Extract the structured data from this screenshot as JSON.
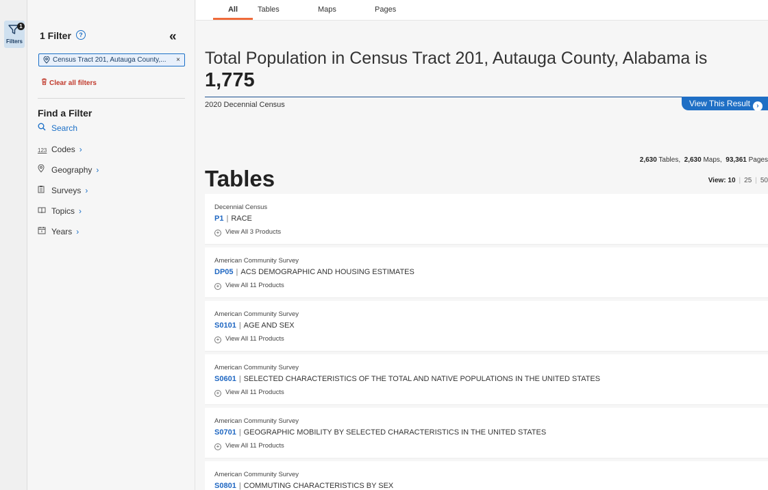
{
  "rail": {
    "filter_label": "Filters",
    "badge_count": "1"
  },
  "panel": {
    "title": "1 Filter",
    "chip_label": "Census Tract 201, Autauga County,...",
    "chip_close": "×",
    "clear_all": "Clear all filters",
    "find_title": "Find a Filter",
    "nav": [
      {
        "label": "Search",
        "icon": "search-icon"
      },
      {
        "label": "Codes",
        "icon": "codes-icon",
        "icon_text": "123"
      },
      {
        "label": "Geography",
        "icon": "location-pin-icon"
      },
      {
        "label": "Surveys",
        "icon": "clipboard-icon"
      },
      {
        "label": "Topics",
        "icon": "book-icon"
      },
      {
        "label": "Years",
        "icon": "calendar-icon"
      }
    ]
  },
  "tabs": [
    "All",
    "Tables",
    "Maps",
    "Pages"
  ],
  "headline": {
    "text": "Total Population in Census Tract 201, Autauga County, Alabama is ",
    "value": "1,775",
    "sub": "2020 Decennial Census",
    "button": "View This Result"
  },
  "counts": {
    "tables_num": "2,630",
    "tables_label": "Tables,",
    "maps_num": "2,630",
    "maps_label": "Maps,",
    "pages_num": "93,361",
    "pages_label": "Pages"
  },
  "section_title": "Tables",
  "view_size": {
    "label": "View:",
    "options": [
      "10",
      "25",
      "50"
    ]
  },
  "results": [
    {
      "survey": "Decennial Census",
      "code": "P1",
      "title": "RACE",
      "more": "View All 3 Products"
    },
    {
      "survey": "American Community Survey",
      "code": "DP05",
      "title": "ACS DEMOGRAPHIC AND HOUSING ESTIMATES",
      "more": "View All 11 Products"
    },
    {
      "survey": "American Community Survey",
      "code": "S0101",
      "title": "AGE AND SEX",
      "more": "View All 11 Products"
    },
    {
      "survey": "American Community Survey",
      "code": "S0601",
      "title": "SELECTED CHARACTERISTICS OF THE TOTAL AND NATIVE POPULATIONS IN THE UNITED STATES",
      "more": "View All 11 Products"
    },
    {
      "survey": "American Community Survey",
      "code": "S0701",
      "title": "GEOGRAPHIC MOBILITY BY SELECTED CHARACTERISTICS IN THE UNITED STATES",
      "more": "View All 11 Products"
    },
    {
      "survey": "American Community Survey",
      "code": "S0801",
      "title": "COMMUTING CHARACTERISTICS BY SEX",
      "more": ""
    }
  ]
}
